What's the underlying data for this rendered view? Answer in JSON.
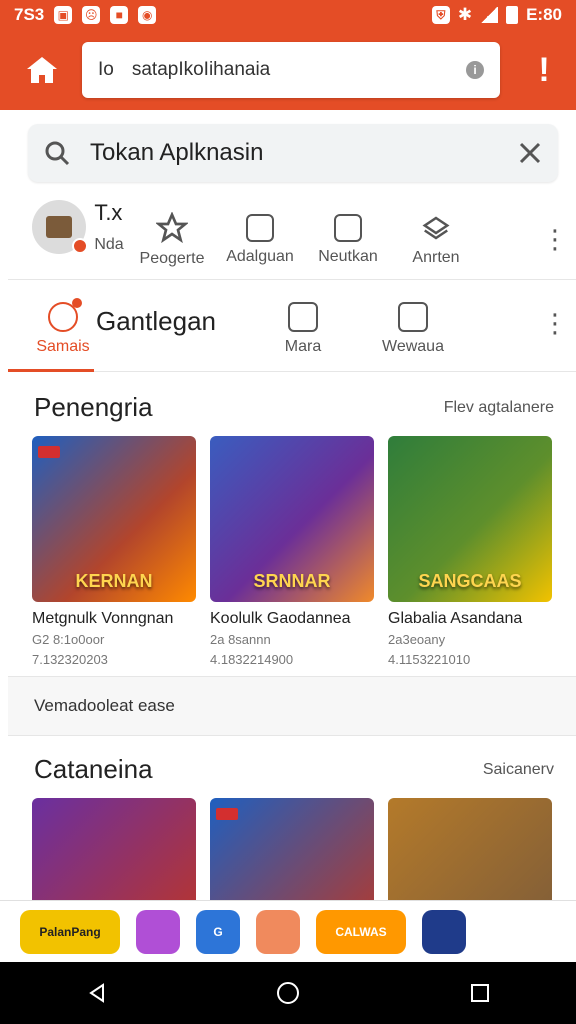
{
  "status_bar": {
    "time": "7S3",
    "right_time": "E:80"
  },
  "app_bar": {
    "url_prefix": "Io",
    "url_text": "satapIkoIihanaia",
    "home_icon": "home-icon",
    "alert_icon": "alert-icon"
  },
  "search": {
    "text": "Tokan Aplknasin",
    "search_icon": "search-icon",
    "close_icon": "close-icon"
  },
  "quick_actions": {
    "first": {
      "title": "T.x",
      "subtitle": "Nda"
    },
    "items": [
      {
        "label": "Peogerte",
        "icon": "star-icon"
      },
      {
        "label": "Adalguan",
        "icon": "controller-icon"
      },
      {
        "label": "Neutkan",
        "icon": "grid-icon"
      },
      {
        "label": "Anrten",
        "icon": "layers-icon"
      }
    ],
    "more_icon": "more-vertical-icon"
  },
  "tabs": {
    "title": "Gantlegan",
    "items": [
      {
        "label": "Samais",
        "icon": "account-icon",
        "active": true
      },
      {
        "label": "Mara",
        "icon": "face-icon",
        "active": false
      },
      {
        "label": "Wewaua",
        "icon": "edit-icon",
        "active": false
      }
    ],
    "more_icon": "more-vertical-icon"
  },
  "section1": {
    "title": "Penengria",
    "link": "Flev agtalanere",
    "cards": [
      {
        "title": "Metgnulk Vonngnan",
        "meta1": "G2 8:1o0oor",
        "meta2": "7.132320203",
        "overlay": "KERNAN",
        "bg": "#b2452c"
      },
      {
        "title": "Koolulk Gaodannea",
        "meta1": "2a 8sannn",
        "meta2": "4.1832214900",
        "overlay": "SRNNAR",
        "bg": "#3a5dbf"
      },
      {
        "title": "Glabalia Asandana",
        "meta1": "2a3eoany",
        "meta2": "4.1153221010",
        "overlay": "SANGCAAS",
        "bg": "#2f7d3b"
      }
    ]
  },
  "banner": {
    "text": "Vemadooleat ease"
  },
  "section2": {
    "title": "Cataneina",
    "link": "Saicanerv",
    "cards": [
      {
        "bg": "#6a2fa0"
      },
      {
        "bg": "#c2361f"
      },
      {
        "bg": "#b47a2a"
      }
    ]
  },
  "bottom_apps": [
    {
      "label": "PalanPang",
      "bg": "#f2c200"
    },
    {
      "label": "",
      "bg": "#b04fd6"
    },
    {
      "label": "G",
      "bg": "#2d75d8"
    },
    {
      "label": "",
      "bg": "#f08a5d"
    },
    {
      "label": "CALWAS",
      "bg": "#ff9800"
    },
    {
      "label": "",
      "bg": "#1f3b8a"
    }
  ],
  "nav": {
    "back_icon": "back-icon",
    "home_icon": "home-circle-icon",
    "recent_icon": "recent-apps-icon"
  }
}
